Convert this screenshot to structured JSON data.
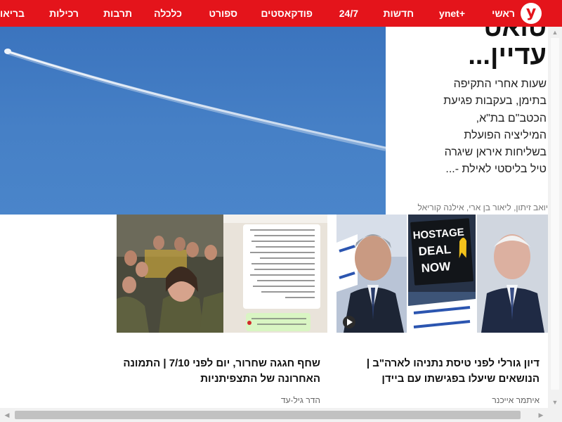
{
  "nav": {
    "items": [
      "ראשי",
      "ynet+",
      "חדשות",
      "24/7",
      "פודקאסטים",
      "ספורט",
      "כלכלה",
      "תרבות",
      "רכילות",
      "בריאות"
    ],
    "logo_letter": "y"
  },
  "hero": {
    "headline_line1": "טואט",
    "headline_line2": "עדיין...",
    "subtitle": "שעות אחרי התקיפה בתימן, בעקבות פגיעת הכטב\"ם בת\"א, המיליציה הפועלת בשליחות איראן שיגרה טיל בליסטי לאילת -...",
    "authors": "יואב זיתון, ליאור בן ארי, אילנה קוריאל"
  },
  "cards": [
    {
      "title": "דיון גורלי לפני טיסת נתניהו לארה\"ב | הנושאים שיעלו בפגישתו עם ביידן",
      "author": "איתמר אייכנר",
      "sign_text": "HOSTAGE DEAL NOW"
    },
    {
      "title": "שחף חגגה שחרור, יום לפני 7/10 | התמונה האחרונה של התצפיתניות",
      "author": "הדר גיל-עד"
    }
  ],
  "colors": {
    "brand_red": "#e4141b",
    "sky_blue": "#4680c6"
  }
}
